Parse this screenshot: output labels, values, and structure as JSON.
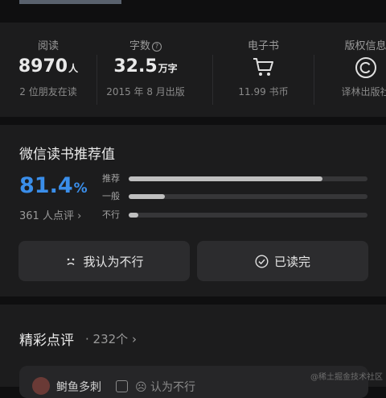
{
  "stats": [
    {
      "label": "阅读",
      "value": "8970",
      "unit": "人",
      "sub": "2 位朋友在读"
    },
    {
      "label": "字数",
      "value": "32.5",
      "unit": "万字",
      "sub": "2015 年 8 月出版"
    },
    {
      "label": "电子书",
      "sub": "11.99 书币",
      "icon": "cart-icon"
    },
    {
      "label": "版权信息",
      "sub": "译林出版社",
      "icon": "copyright-icon"
    }
  ],
  "recommend": {
    "title": "微信读书推荐值",
    "percent": "81.4",
    "percent_sign": "%",
    "raters": "361 人点评",
    "bars": [
      {
        "label": "推荐",
        "fraction": 0.81
      },
      {
        "label": "一般",
        "fraction": 0.15
      },
      {
        "label": "不行",
        "fraction": 0.04
      }
    ],
    "buttons": {
      "dislike": "我认为不行",
      "read": "已读完"
    }
  },
  "reviews": {
    "title": "精彩点评",
    "count": "· 232个",
    "first": {
      "user": "鲥鱼多刺",
      "verdict": "认为不行"
    }
  },
  "watermark": "@稀土掘金技术社区"
}
